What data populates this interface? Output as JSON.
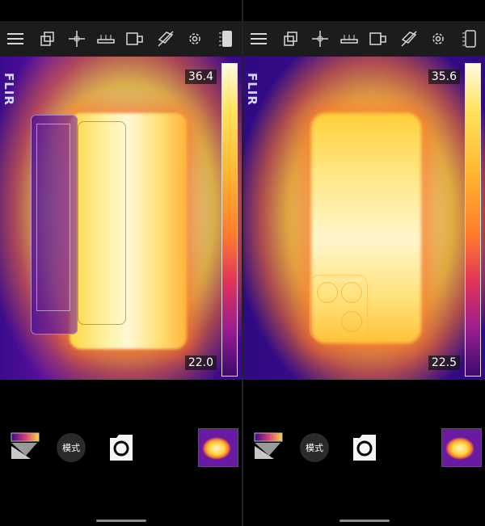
{
  "toolbar_icons": [
    "menu-icon",
    "duplicate-icon",
    "crosshair-icon",
    "ruler-icon",
    "box-flip-icon",
    "flash-off-icon",
    "gear-icon",
    "scale-bar-icon"
  ],
  "left": {
    "brand": "FLIR",
    "temp_max": "36.4",
    "temp_min": "22.0",
    "mode_label": "模式"
  },
  "right": {
    "brand": "FLIR",
    "temp_max": "35.6",
    "temp_min": "22.5",
    "mode_label": "模式"
  },
  "colors": {
    "toolbar_bg": "#1c1c1c",
    "icon": "#d8d8d8",
    "background": "#000000"
  }
}
